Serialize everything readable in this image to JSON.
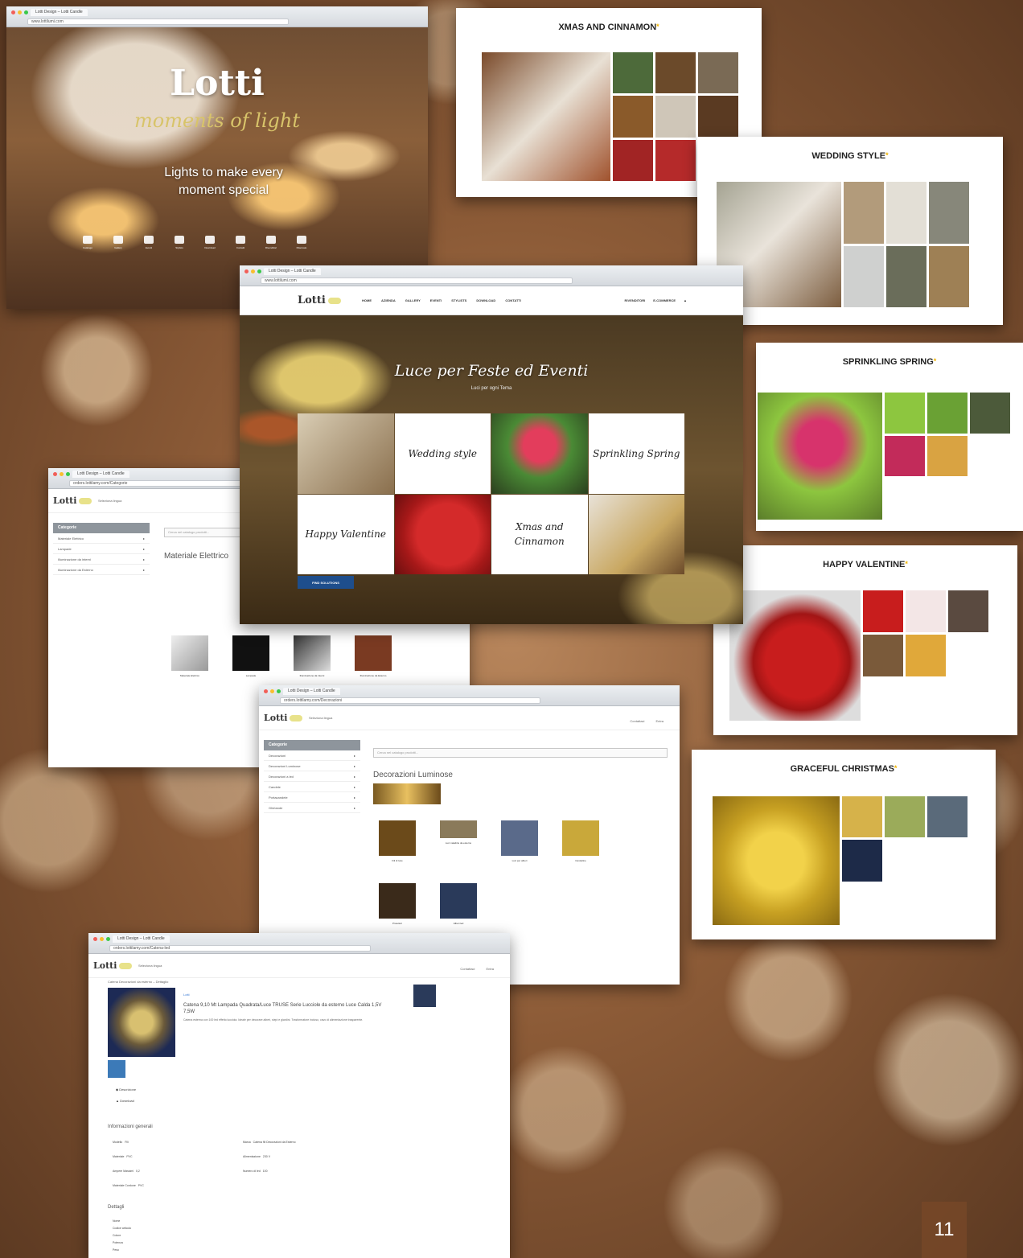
{
  "hero": {
    "tab": "Lotti Design – Lotti Candle",
    "url": "www.lottilumi.com",
    "title": "Lotti",
    "subtitle": "moments of light",
    "tagline": "Lights to make every moment special",
    "icons": [
      {
        "icon": "catalog-icon",
        "label": "Catalogo"
      },
      {
        "icon": "gallery-icon",
        "label": "Gallery"
      },
      {
        "icon": "events-icon",
        "label": "Eventi"
      },
      {
        "icon": "stylish-icon",
        "label": "Stylists"
      },
      {
        "icon": "download-icon",
        "label": "Download"
      },
      {
        "icon": "user-icon",
        "label": "Contatti"
      },
      {
        "icon": "cart-icon",
        "label": "Rivenditori"
      },
      {
        "icon": "check-icon",
        "label": "Riservato"
      }
    ]
  },
  "cards": {
    "xmas": {
      "title": "XMAS AND CINNAMON"
    },
    "wedding": {
      "title": "WEDDING STYLE"
    },
    "spring": {
      "title": "SPRINKLING SPRING"
    },
    "valentine": {
      "title": "HAPPY VALENTINE"
    },
    "christmas": {
      "title": "GRACEFUL CHRISTMAS"
    }
  },
  "main": {
    "tab": "Lotti Design – Lotti Candle",
    "url": "www.lottilumi.com",
    "logo": "Lotti",
    "nav": [
      "HOME",
      "AZIENDA",
      "GALLERY",
      "EVENTI",
      "STYLISTS",
      "DOWNLOAD",
      "CONTATTI"
    ],
    "nav_right": [
      "RIVENDITORI",
      "E-COMMERCE"
    ],
    "headline": "Luce per Feste ed Eventi",
    "subline": "Luci per ogni Tema",
    "tiles": [
      "Wedding style",
      "Sprinkling Spring",
      "Happy Valentine",
      "Xmas and Cinnamon"
    ],
    "button": "FIND SOLUTIONS"
  },
  "cat1": {
    "tab": "Lotti Design – Lotti Candle",
    "url": "orders.lottilamy.com/Categorie",
    "logo": "Lotti",
    "lang": "Seleziona lingua",
    "side_header": "Categorie",
    "side_items": [
      "Materiale Elettrico",
      "Lampade",
      "Illuminazione da interni",
      "Illuminazione da Esterno"
    ],
    "search_placeholder": "Cerca nel catalogo prodotti...",
    "section": "Materiale Elettrico",
    "thumbs": [
      "Materiale Elettrico",
      "Lampade",
      "Illuminazione da interni",
      "Illuminazione da Esterno"
    ]
  },
  "cat2": {
    "tab": "Lotti Design – Lotti Candle",
    "url": "orders.lottilamy.com/Decorazioni",
    "logo": "Lotti",
    "lang": "Seleziona lingua",
    "right_links": [
      "Contattaci",
      "Entra"
    ],
    "side_header": "Categorie",
    "side_items": [
      "Decorazioni",
      "Decorazioni Luminose",
      "Decorazioni a led",
      "Candele",
      "Portacandele",
      "Ghirlande"
    ],
    "search_placeholder": "Cerca nel catalogo prodotti...",
    "section": "Decorazioni Luminose",
    "thumbs": [
      "Fili di luce",
      "Luci natalizie da esterno",
      "Luci per alberi",
      "Candeline",
      "Proiettori",
      "Alberi led"
    ]
  },
  "detail": {
    "tab": "Lotti Design – Lotti Candle",
    "url": "orders.lottilamy.com/Catena-led",
    "logo": "Lotti",
    "lang": "Seleziona lingua",
    "right_links": [
      "Contattaci",
      "Entra"
    ],
    "breadcrumb": "Catena Decorazioni da esterno – Dettaglio",
    "brand": "Lotti",
    "title": "Catena 9,10 Mt Lampada Quadrata/Luce TRUSE Serie Lucciole da esterno Luce Calda 1,5V 7,5W",
    "desc": "Catena esterna con 100 led effetto lucciola. Ideale per decorare alberi, siepi e giardini. Trasformatore incluso, cavo di alimentazione trasparente.",
    "actions": [
      "Descrizione",
      "Download"
    ],
    "info_header": "Informazioni generali",
    "info": [
      {
        "k": "Modello",
        "v": "Fili"
      },
      {
        "k": "Materiale",
        "v": "PVC"
      },
      {
        "k": "Ampere Massimi",
        "v": "0,2"
      },
      {
        "k": "Materiale Cordone",
        "v": "PVC"
      }
    ],
    "info_right": [
      {
        "k": "Marca",
        "v": "Catena fili Decorazioni da Esterno"
      },
      {
        "k": "Alimentazione",
        "v": "230 V"
      },
      {
        "k": "Numero di led",
        "v": "100"
      }
    ],
    "sub_header": "Dettagli",
    "sub_rows": [
      "Nome",
      "Codice articolo",
      "Colore",
      "Potenza",
      "Peso"
    ]
  },
  "page_number": "11"
}
